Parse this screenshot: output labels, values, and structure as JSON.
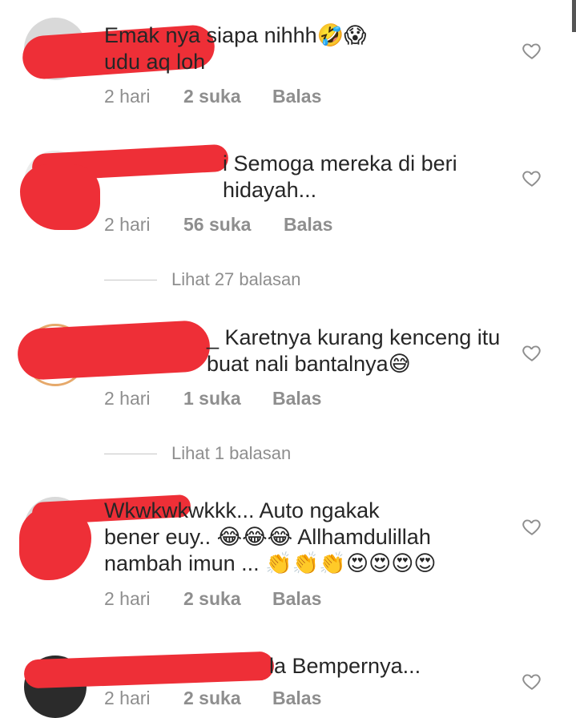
{
  "comments": [
    {
      "text": "Emak nya siapa nihhh🤣😱\nudu aq loh",
      "time": "2 hari",
      "likes": "2 suka",
      "reply": "Balas"
    },
    {
      "text": "i Semoga mereka di beri\nhidayah...",
      "time": "2 hari",
      "likes": "56 suka",
      "reply": "Balas"
    },
    {
      "text": "_ Karetnya kurang kenceng itu\nbuat nali bantalnya😅",
      "time": "2 hari",
      "likes": "1 suka",
      "reply": "Balas"
    },
    {
      "text": "Wkwkwkwkkk... Auto ngakak\nbener euy.. 😂😂😂 Allhamdulillah\nnambah imun ... 👏👏👏😍😍😍😍",
      "time": "2 hari",
      "likes": "2 suka",
      "reply": "Balas"
    },
    {
      "text": "la Bempernya...",
      "time": "2 hari",
      "likes": "2 suka",
      "reply": "Balas"
    }
  ],
  "threads": [
    {
      "label": "Lihat 27 balasan"
    },
    {
      "label": "Lihat 1 balasan"
    }
  ],
  "icons": {
    "like": "heart-outline-icon"
  },
  "colors": {
    "redaction": "#ee2f37",
    "meta": "#8e8e8e",
    "text": "#262626"
  }
}
